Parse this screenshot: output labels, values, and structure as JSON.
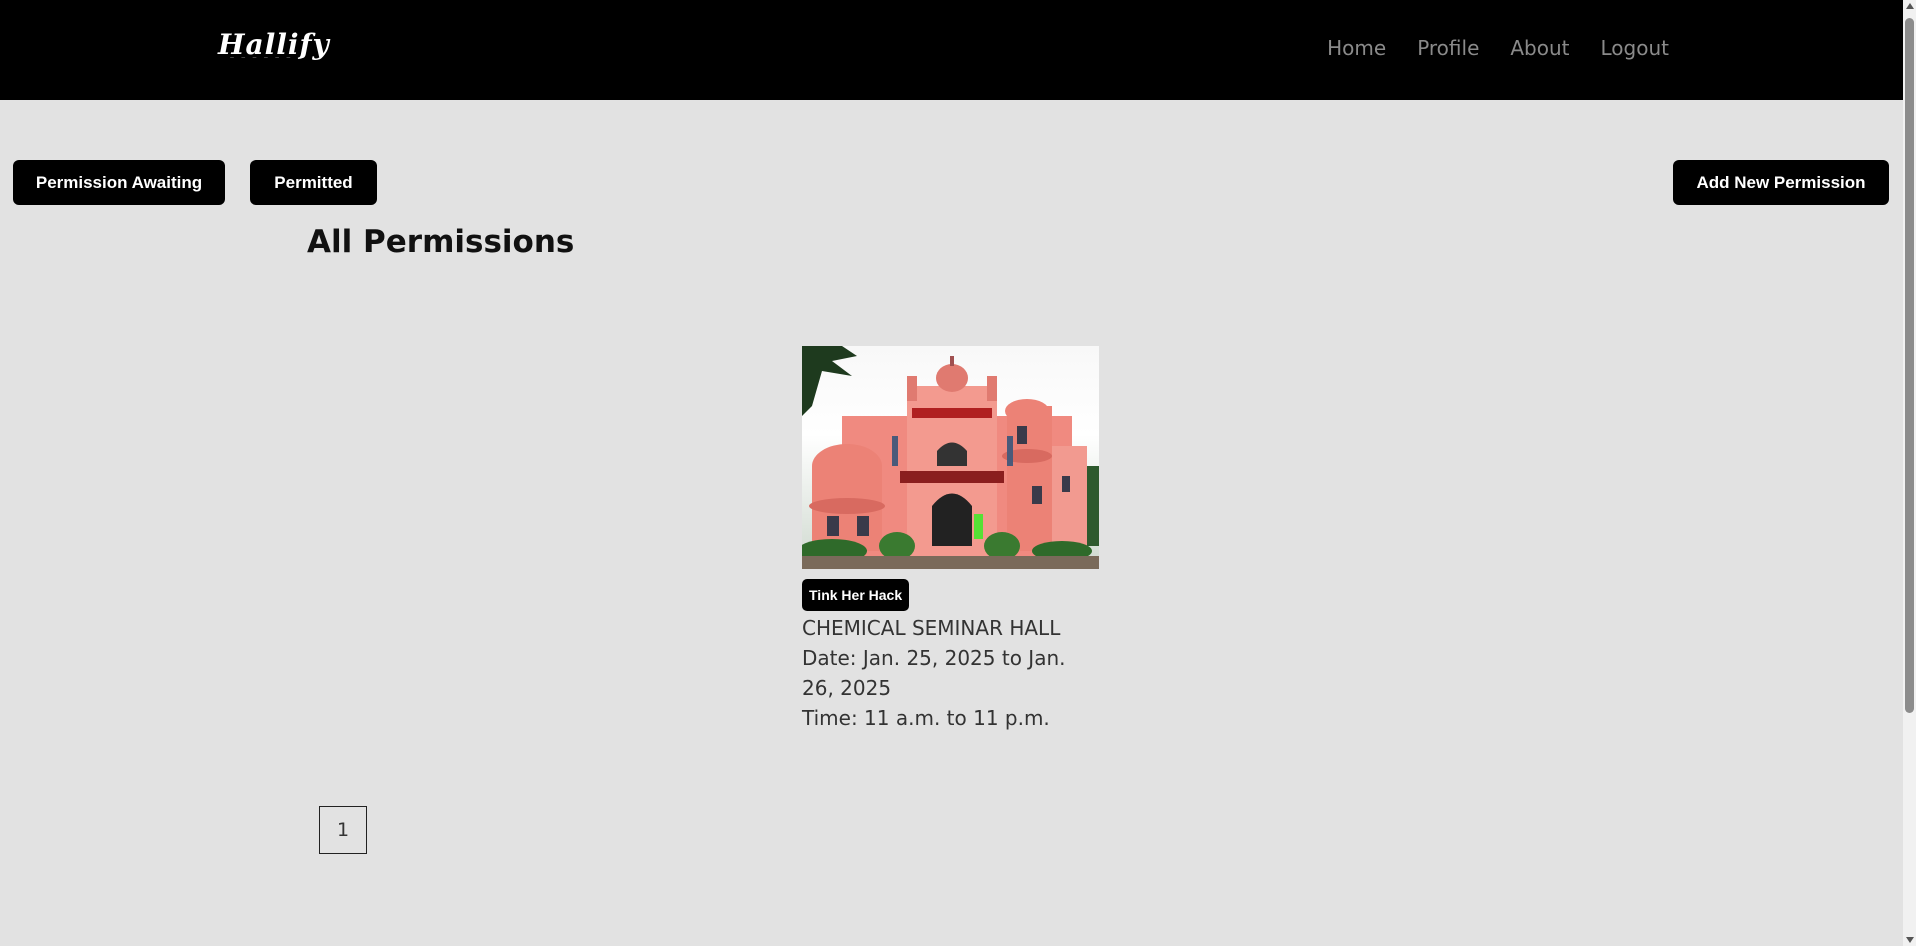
{
  "header": {
    "logo_text": "Hallify",
    "nav": [
      "Home",
      "Profile",
      "About",
      "Logout"
    ]
  },
  "toolbar": {
    "awaiting_label": "Permission Awaiting",
    "permitted_label": "Permitted",
    "add_label": "Add New Permission"
  },
  "page": {
    "title": "All Permissions"
  },
  "permissions": [
    {
      "event": "Tink Her Hack",
      "hall": "CHEMICAL SEMINAR HALL",
      "date": "Date: Jan. 25, 2025 to Jan. 26, 2025",
      "time": "Time: 11 a.m. to 11 p.m."
    }
  ],
  "pagination": {
    "current": "1"
  },
  "colors": {
    "background": "#e2e2e2",
    "navbar": "#000000",
    "button": "#000000",
    "building": "#f08a80"
  }
}
